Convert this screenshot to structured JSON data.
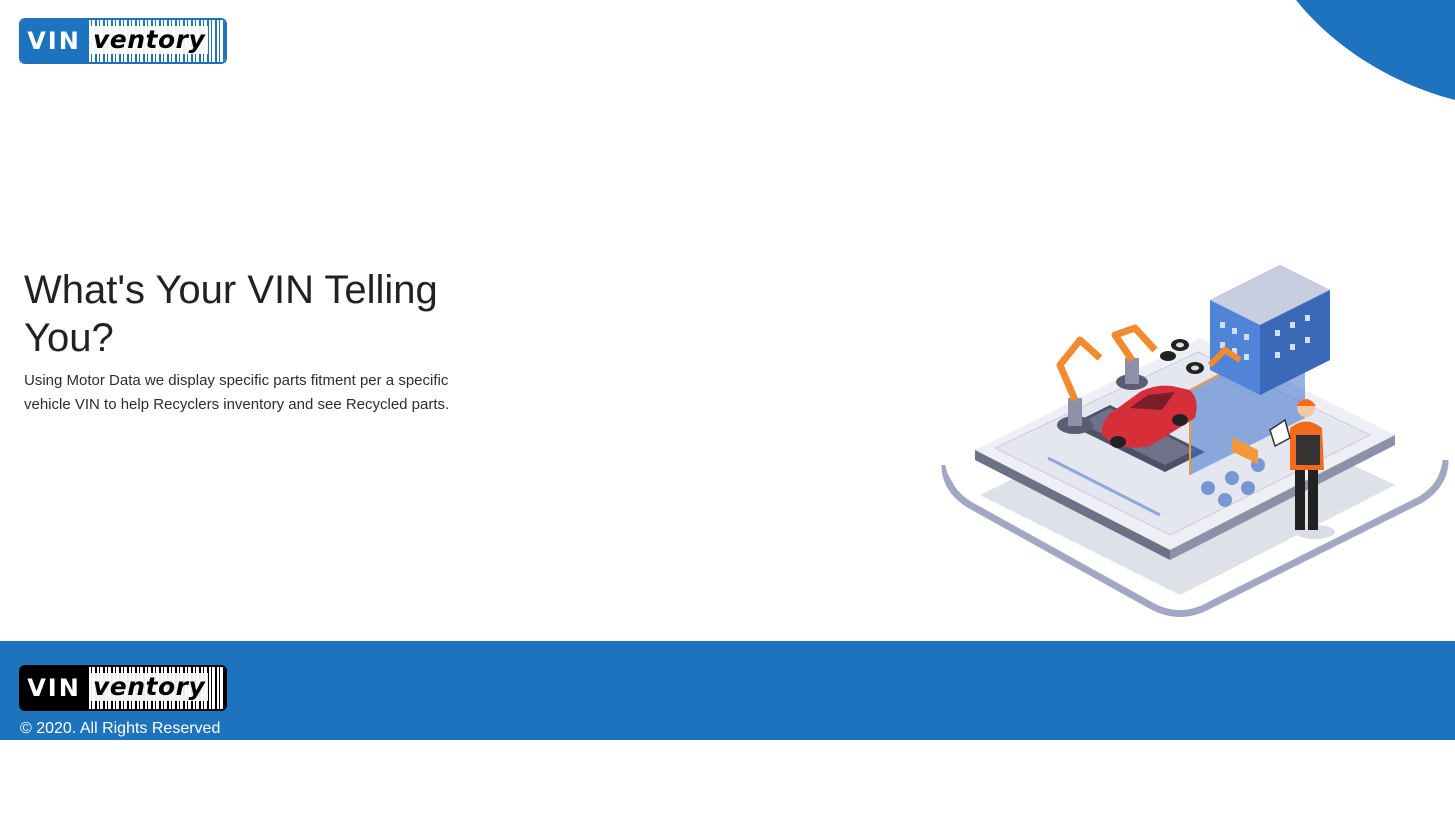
{
  "header": {
    "logo": {
      "vin_text": "VIN",
      "ventory_text": "ventory"
    }
  },
  "hero": {
    "title": "What's Your VIN Telling You?",
    "description": "Using Motor Data we display specific parts fitment per a specific vehicle VIN to help Recyclers inventory and see Recycled parts.",
    "illustration_icon": "factory-assembly-illustration"
  },
  "footer": {
    "logo": {
      "vin_text": "VIN",
      "ventory_text": "ventory"
    },
    "copyright": "© 2020. All Rights Reserved"
  },
  "colors": {
    "brand_blue": "#1e73be",
    "text_dark": "#222222",
    "white": "#ffffff"
  }
}
